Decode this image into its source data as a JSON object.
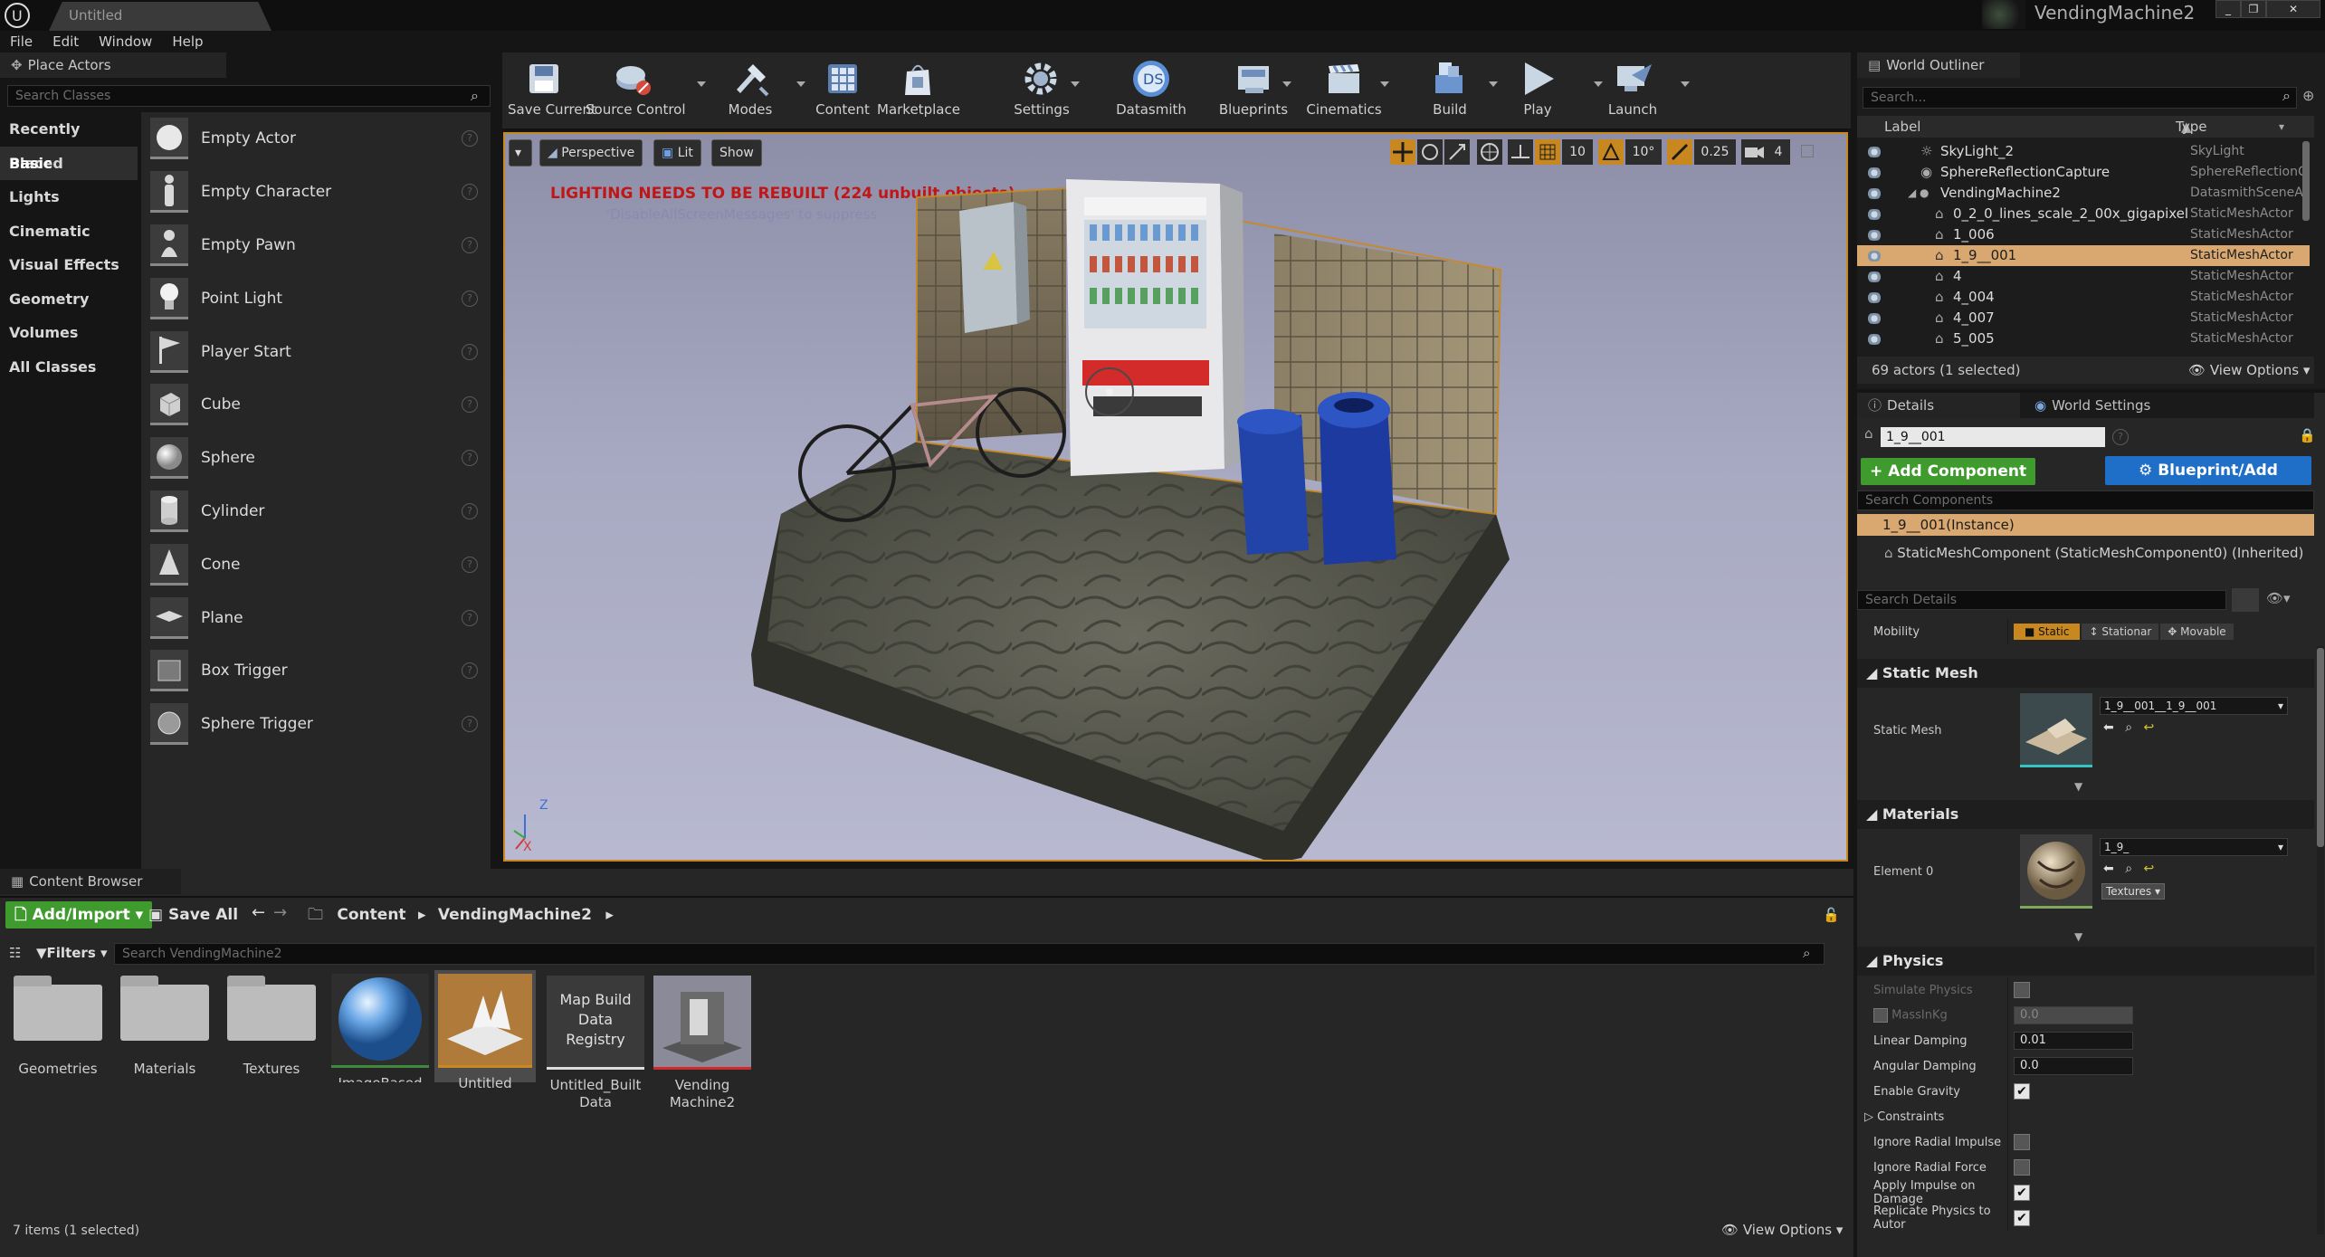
{
  "window": {
    "tab_title": "Untitled",
    "project_name": "VendingMachine2",
    "controls": [
      "_",
      "❐",
      "✕"
    ]
  },
  "menu": [
    "File",
    "Edit",
    "Window",
    "Help"
  ],
  "place_actors": {
    "tab_label": "Place Actors",
    "search_placeholder": "Search Classes",
    "categories": [
      "Recently Placed",
      "Basic",
      "Lights",
      "Cinematic",
      "Visual Effects",
      "Geometry",
      "Volumes",
      "All Classes"
    ],
    "active_category": "Basic",
    "actors": [
      "Empty Actor",
      "Empty Character",
      "Empty Pawn",
      "Point Light",
      "Player Start",
      "Cube",
      "Sphere",
      "Cylinder",
      "Cone",
      "Plane",
      "Box Trigger",
      "Sphere Trigger"
    ]
  },
  "toolbar": {
    "buttons": [
      "Save Current",
      "Source Control",
      "Modes",
      "Content",
      "Marketplace",
      "Settings",
      "Datasmith",
      "Blueprints",
      "Cinematics",
      "Build",
      "Play",
      "Launch"
    ]
  },
  "viewport": {
    "perspective_label": "Perspective",
    "lit_label": "Lit",
    "show_label": "Show",
    "grid_snap": "10",
    "rotation_snap": "10°",
    "scale_snap": "0.25",
    "camera_speed": "4",
    "warning": "LIGHTING NEEDS TO BE REBUILT (224 unbuilt objects)",
    "warning_sub": "'DisableAllScreenMessages' to suppress",
    "axis_z": "Z",
    "axis_x": "X"
  },
  "outliner": {
    "tab_label": "World Outliner",
    "search_placeholder": "Search...",
    "col_label": "Label",
    "col_type": "Type",
    "rows": [
      {
        "label": "SkyLight_2",
        "type": "SkyLight",
        "indent": 1
      },
      {
        "label": "SphereReflectionCapture",
        "type": "SphereReflectionC",
        "indent": 1
      },
      {
        "label": "VendingMachine2",
        "type": "DatasmithSceneAc",
        "indent": 1
      },
      {
        "label": "0_2_0_lines_scale_2_00x_gigapixel",
        "type": "StaticMeshActor",
        "indent": 2
      },
      {
        "label": "1_006",
        "type": "StaticMeshActor",
        "indent": 2
      },
      {
        "label": "1_9__001",
        "type": "StaticMeshActor",
        "indent": 2
      },
      {
        "label": "4",
        "type": "StaticMeshActor",
        "indent": 2
      },
      {
        "label": "4_004",
        "type": "StaticMeshActor",
        "indent": 2
      },
      {
        "label": "4_007",
        "type": "StaticMeshActor",
        "indent": 2
      },
      {
        "label": "5_005",
        "type": "StaticMeshActor",
        "indent": 2
      }
    ],
    "selected": "1_9__001",
    "status": "69 actors (1 selected)",
    "view_options": "View Options"
  },
  "details": {
    "tab_label": "Details",
    "world_settings_label": "World Settings",
    "object_name": "1_9__001",
    "add_component": "+ Add Component",
    "blueprint_script": "Blueprint/Add Script",
    "search_components_placeholder": "Search Components",
    "instance_row": "1_9__001(Instance)",
    "component_row": "StaticMeshComponent (StaticMeshComponent0) (Inherited)",
    "search_details_placeholder": "Search Details",
    "mobility_label": "Mobility",
    "mobility_options": [
      "Static",
      "Stationar",
      "Movable"
    ],
    "mobility_selected": "Static",
    "static_mesh_section": "Static Mesh",
    "static_mesh_label": "Static Mesh",
    "static_mesh_value": "1_9__001__1_9__001",
    "materials_section": "Materials",
    "element_label": "Element 0",
    "element_value": "1_9_",
    "textures_label": "Textures",
    "physics_section": "Physics",
    "physics": [
      {
        "name": "Simulate Physics",
        "kind": "check",
        "value": false,
        "disabled": true
      },
      {
        "name": "MassInKg",
        "kind": "number",
        "value": "0.0",
        "disabled": true
      },
      {
        "name": "Linear Damping",
        "kind": "number",
        "value": "0.01"
      },
      {
        "name": "Angular Damping",
        "kind": "number",
        "value": "0.0"
      },
      {
        "name": "Enable Gravity",
        "kind": "check",
        "value": true
      },
      {
        "name": "Constraints",
        "kind": "group"
      },
      {
        "name": "Ignore Radial Impulse",
        "kind": "check",
        "value": false
      },
      {
        "name": "Ignore Radial Force",
        "kind": "check",
        "value": false
      },
      {
        "name": "Apply Impulse on Damage",
        "kind": "check",
        "value": true
      },
      {
        "name": "Replicate Physics to Autor",
        "kind": "check",
        "value": true
      }
    ]
  },
  "content_browser": {
    "tab_label": "Content Browser",
    "add_import": "Add/Import",
    "save_all": "Save All",
    "path": [
      "Content",
      "VendingMachine2"
    ],
    "filters_label": "Filters",
    "search_placeholder": "Search VendingMachine2",
    "assets": [
      {
        "name": "Geometries",
        "kind": "folder"
      },
      {
        "name": "Materials",
        "kind": "folder"
      },
      {
        "name": "Textures",
        "kind": "folder"
      },
      {
        "name": "ImageBased Environment Material",
        "kind": "material"
      },
      {
        "name": "Untitled",
        "kind": "level"
      },
      {
        "name": "Untitled_Built Data",
        "kind": "registry"
      },
      {
        "name": "Vending Machine2",
        "kind": "scene"
      }
    ],
    "registry_thumb_text": "Map Build Data Registry",
    "status": "7 items (1 selected)",
    "view_options": "View Options"
  },
  "colors": {
    "accent_orange": "#c9881f",
    "selection": "#d9a870",
    "green_button": "#3f9b2e",
    "blue_button": "#1f6fc9",
    "warning_red": "#c01616"
  }
}
